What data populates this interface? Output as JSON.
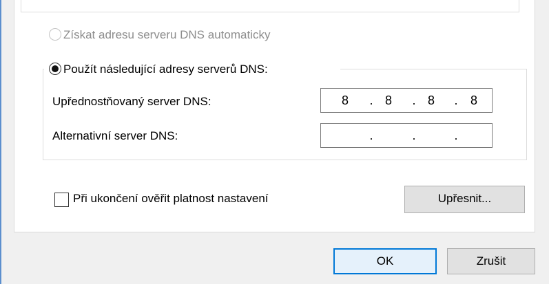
{
  "dns": {
    "auto_label": "Získat adresu serveru DNS automaticky",
    "auto_selected": false,
    "auto_enabled": false,
    "manual_label": "Použít následující adresy serverů DNS:",
    "manual_selected": true,
    "preferred_label": "Upřednostňovaný server DNS:",
    "preferred_octets": [
      "8",
      "8",
      "8",
      "8"
    ],
    "alternate_label": "Alternativní server DNS:",
    "alternate_octets": [
      "",
      "",
      "",
      ""
    ],
    "separator": "."
  },
  "validate": {
    "label": "Při ukončení ověřit platnost nastavení",
    "checked": false
  },
  "buttons": {
    "advanced": "Upřesnit...",
    "ok": "OK",
    "cancel": "Zrušit"
  },
  "colors": {
    "accent": "#0078d7",
    "disabled_text": "#8d8d8d",
    "window_edge": "#5c8fce"
  }
}
